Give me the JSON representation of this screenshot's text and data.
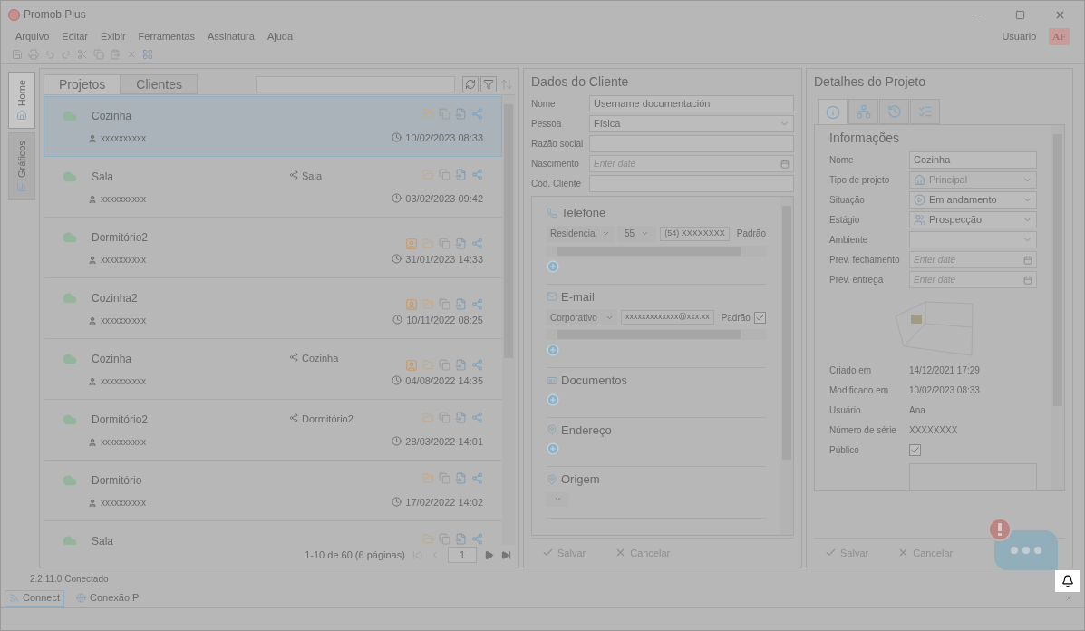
{
  "window": {
    "title": "Promob Plus"
  },
  "menu": [
    "Arquivo",
    "Editar",
    "Exibir",
    "Ferramentas",
    "Assinatura",
    "Ajuda"
  ],
  "user": {
    "name": "Usuario",
    "initials": "AF"
  },
  "side_tabs": [
    {
      "label": "Home",
      "selected": true
    },
    {
      "label": "Gráficos",
      "selected": false
    }
  ],
  "projects": {
    "tabs": [
      {
        "label": "Projetos",
        "selected": true
      },
      {
        "label": "Clientes",
        "selected": false
      }
    ],
    "rows": [
      {
        "name": "Cozinha",
        "client": "xxxxxxxxxx",
        "date": "10/02/2023 08:33",
        "selected": true,
        "owner": false
      },
      {
        "name": "Sala",
        "room": "Sala",
        "client": "xxxxxxxxxx",
        "date": "03/02/2023 09:42",
        "selected": false,
        "owner": false
      },
      {
        "name": "Dormitório2",
        "client": "xxxxxxxxxx",
        "date": "31/01/2023 14:33",
        "selected": false,
        "owner": true
      },
      {
        "name": "Cozinha2",
        "client": "xxxxxxxxxx",
        "date": "10/11/2022 08:25",
        "selected": false,
        "owner": true
      },
      {
        "name": "Cozinha",
        "room": "Cozinha",
        "client": "xxxxxxxxxx",
        "date": "04/08/2022 14:35",
        "selected": false,
        "owner": true
      },
      {
        "name": "Dormitório2",
        "room": "Dormitório2",
        "client": "xxxxxxxxxx",
        "date": "28/03/2022 14:01",
        "selected": false,
        "owner": false
      },
      {
        "name": "Dormitório",
        "client": "xxxxxxxxxx",
        "date": "17/02/2022 14:02",
        "selected": false,
        "owner": false
      },
      {
        "name": "Sala",
        "selected": false,
        "owner": false
      }
    ],
    "pagination": {
      "summary": "1-10 de 60 (6 páginas)",
      "page": "1"
    }
  },
  "client": {
    "title": "Dados do Cliente",
    "fields": [
      {
        "label": "Nome",
        "kind": "text",
        "value": "Username documentación"
      },
      {
        "label": "Pessoa",
        "kind": "select",
        "value": "Física"
      },
      {
        "label": "Razão social",
        "kind": "text"
      },
      {
        "label": "Nascimento",
        "kind": "date",
        "placeholder": "Enter date"
      },
      {
        "label": "Cód. Cliente",
        "kind": "text"
      }
    ],
    "sections": [
      {
        "title": "Telefone",
        "kind": "phone",
        "type": "Residencial",
        "code": "55",
        "value": "(54) XXXXXXXX",
        "default_label": "Padrão"
      },
      {
        "title": "E-mail",
        "kind": "email",
        "type": "Corporativo",
        "value": "xxxxxxxxxxxxx@xxx.xx",
        "default_label": "Padrão",
        "checked": true
      },
      {
        "title": "Documentos",
        "kind": "list"
      },
      {
        "title": "Endereço",
        "kind": "list"
      },
      {
        "title": "Origem",
        "kind": "select"
      }
    ],
    "buttons": [
      {
        "label": "Salvar",
        "disabled": true
      },
      {
        "label": "Cancelar",
        "disabled": true
      }
    ]
  },
  "details": {
    "title": "Detalhes do Projeto",
    "tabs": [
      {
        "selected": true
      },
      {
        "selected": false
      },
      {
        "selected": false
      },
      {
        "selected": false
      }
    ],
    "section": "Informações",
    "fields": [
      {
        "label": "Nome",
        "kind": "text",
        "value": "Cozinha"
      },
      {
        "label": "Tipo de projeto",
        "kind": "select",
        "value": "Principal",
        "disabled": true
      },
      {
        "label": "Situação",
        "kind": "select",
        "value": "Em andamento"
      },
      {
        "label": "Estágio",
        "kind": "select",
        "value": "Prospecção"
      },
      {
        "label": "Ambiente",
        "kind": "select"
      },
      {
        "label": "Prev. fechamento",
        "kind": "date",
        "placeholder": "Enter date"
      },
      {
        "label": "Prev. entrega",
        "kind": "date",
        "placeholder": "Enter date"
      }
    ],
    "info": [
      {
        "label": "Criado em",
        "value": "14/12/2021 17:29"
      },
      {
        "label": "Modificado em",
        "value": "10/02/2023 08:33"
      },
      {
        "label": "Usuário",
        "value": "Ana"
      },
      {
        "label": "Número de série",
        "value": "XXXXXXXX"
      }
    ],
    "public": {
      "label": "Público",
      "checked": true
    },
    "buttons": [
      {
        "label": "Salvar",
        "disabled": true
      },
      {
        "label": "Cancelar",
        "disabled": true
      }
    ]
  },
  "status": "2.2.11.0 Conectado",
  "taskbar": [
    {
      "label": "Connect",
      "selected": true
    },
    {
      "label": "Conexão P",
      "selected": false
    }
  ]
}
